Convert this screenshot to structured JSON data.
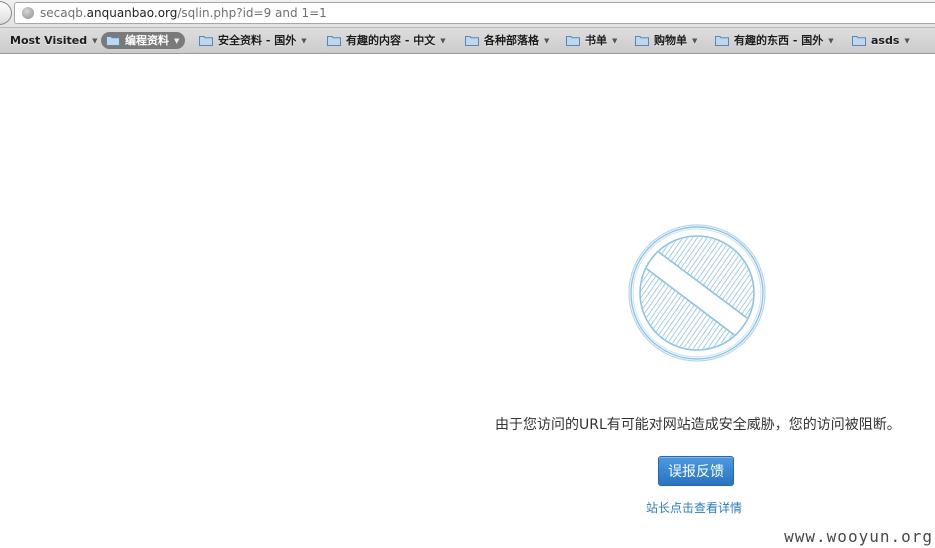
{
  "address_bar": {
    "url_host_prefix": "secaqb.",
    "url_host_domain": "anquanbao.org",
    "url_path": "/sqlin.php?id=9 and 1=1"
  },
  "bookmarks_toolbar": {
    "items": [
      {
        "label": "Most Visited",
        "icon": "none"
      },
      {
        "label": "编程资料",
        "icon": "folder-icon"
      },
      {
        "label": "安全资料 - 国外",
        "icon": "folder-icon"
      },
      {
        "label": "有趣的内容 - 中文",
        "icon": "folder-icon"
      },
      {
        "label": "各种部落格",
        "icon": "folder-icon"
      },
      {
        "label": "书单",
        "icon": "folder-icon"
      },
      {
        "label": "购物单",
        "icon": "folder-icon"
      },
      {
        "label": "有趣的东西 - 国外",
        "icon": "folder-icon"
      },
      {
        "label": "asds",
        "icon": "folder-icon"
      }
    ]
  },
  "page": {
    "block_icon": "blocked-sign-icon",
    "message": "由于您访问的URL有可能对网站造成安全威胁，您的访问被阻断。",
    "report_button": "误报反馈",
    "details_link": "站长点击查看详情"
  },
  "watermark": "www.wooyun.org",
  "colors": {
    "accent": "#2a7bc6",
    "button": "#3585d3",
    "icon_stroke": "#8cc3e6"
  }
}
